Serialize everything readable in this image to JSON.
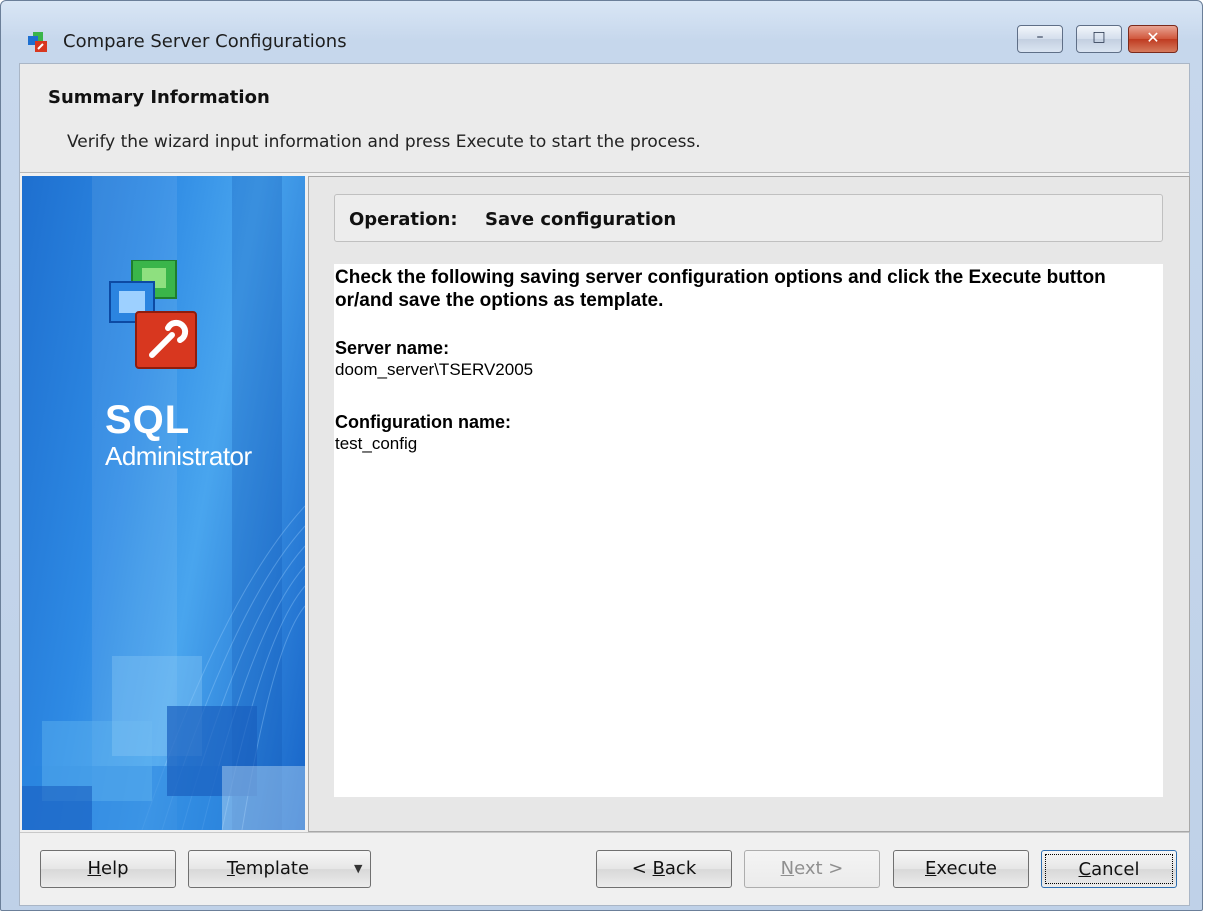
{
  "window": {
    "title": "Compare Server Configurations",
    "controls": {
      "minimize": "–",
      "maximize": "□",
      "close": "✕"
    }
  },
  "header": {
    "title": "Summary Information",
    "description": "Verify the wizard input information and press Execute to start the process."
  },
  "sidepanel": {
    "brand_line1": "SQL",
    "brand_line2": "Administrator"
  },
  "operation": {
    "label": "Operation:",
    "value": "Save configuration"
  },
  "summary": {
    "intro": "Check the following saving server configuration options and click the Execute button or/and save the options as template.",
    "server_name_label": "Server name:",
    "server_name_value": "doom_server\\TSERV2005",
    "config_name_label": "Configuration name:",
    "config_name_value": "test_config"
  },
  "buttons": {
    "help": {
      "prefix": "",
      "hotkey": "H",
      "suffix": "elp"
    },
    "template": {
      "prefix": "",
      "hotkey": "T",
      "suffix": "emplate"
    },
    "back": {
      "prefix": "< ",
      "hotkey": "B",
      "suffix": "ack"
    },
    "next": {
      "prefix": "",
      "hotkey": "N",
      "suffix": "ext >"
    },
    "execute": {
      "prefix": "",
      "hotkey": "E",
      "suffix": "xecute"
    },
    "cancel": {
      "prefix": "",
      "hotkey": "C",
      "suffix": "ancel"
    }
  },
  "colors": {
    "accent": "#1e6fcf",
    "logo_green": "#3ab54a",
    "logo_red": "#d8371f",
    "logo_blue": "#1d6fd0"
  },
  "icons": [
    "app-icon",
    "sql-administrator-logo",
    "dropdown-arrow-icon"
  ]
}
